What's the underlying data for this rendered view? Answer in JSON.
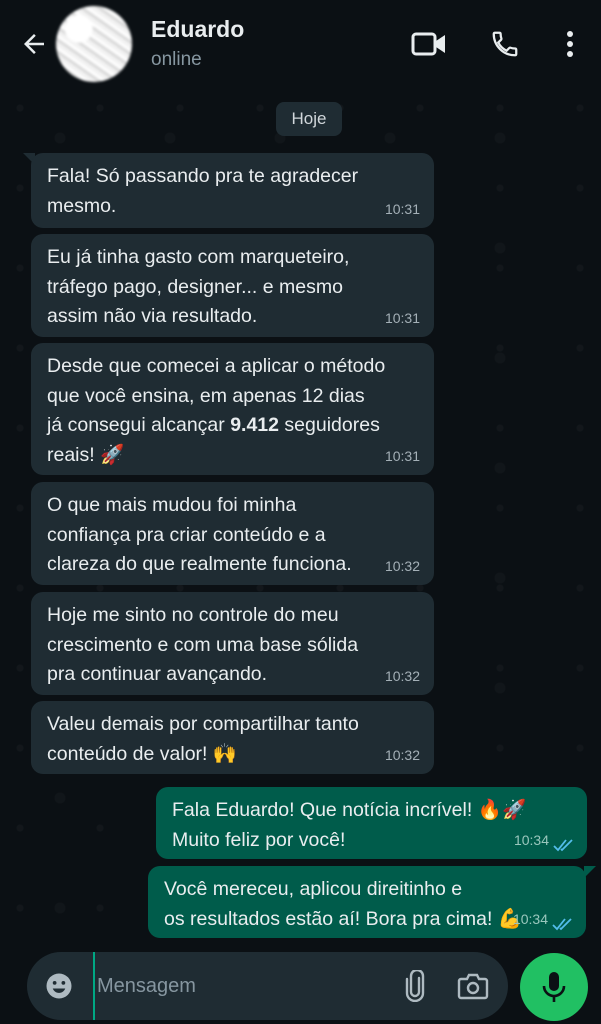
{
  "header": {
    "back_icon": "arrow-left-icon",
    "contact_name": "Eduardo",
    "status": "online",
    "icons": [
      "video-call-icon",
      "phone-icon",
      "more-vert-icon"
    ]
  },
  "chat": {
    "date_chip": "Hoje",
    "messages": [
      {
        "direction": "in",
        "text": "Fala! Só passando pra te agradecer\nmesmo.",
        "time": "10:31"
      },
      {
        "direction": "in",
        "text": "Eu já tinha gasto com marqueteiro,\ntráfego pago, designer... e mesmo\nassim não via resultado.",
        "time": "10:31"
      },
      {
        "direction": "in",
        "text_before": "Desde que comecei a aplicar o método\nque você ensina, em apenas 12 dias\njá consegui alcançar ",
        "text_bold": "9.412",
        "text_after": " seguidores\nreais! 🚀",
        "time": "10:31"
      },
      {
        "direction": "in",
        "text": "O que mais mudou foi minha\nconfiança pra criar conteúdo e a\nclareza do que realmente funciona.",
        "time": "10:32"
      },
      {
        "direction": "in",
        "text": "Hoje me sinto no controle do meu\ncrescimento e com uma base sólida\npra continuar avançando.",
        "time": "10:32"
      },
      {
        "direction": "in",
        "text": "Valeu demais por compartilhar tanto\nconteúdo de valor! 🙌",
        "time": "10:32"
      },
      {
        "direction": "out",
        "text": "Fala Eduardo! Que notícia incrível! 🔥🚀\nMuito feliz por você!",
        "time": "10:34",
        "status": "read"
      },
      {
        "direction": "out",
        "text": "Você mereceu, aplicou direitinho e\nos resultados estão aí! Bora pra cima! 💪",
        "time": "10:34",
        "status": "read"
      }
    ]
  },
  "composer": {
    "placeholder": "Mensagem",
    "icons": [
      "emoji-icon",
      "attach-icon",
      "camera-icon",
      "mic-icon"
    ]
  },
  "colors": {
    "background": "#0b1014",
    "incoming_bubble": "#1f2c33",
    "outgoing_bubble": "#005c4b",
    "accent": "#21c063",
    "read_ticks": "#53bdeb"
  }
}
